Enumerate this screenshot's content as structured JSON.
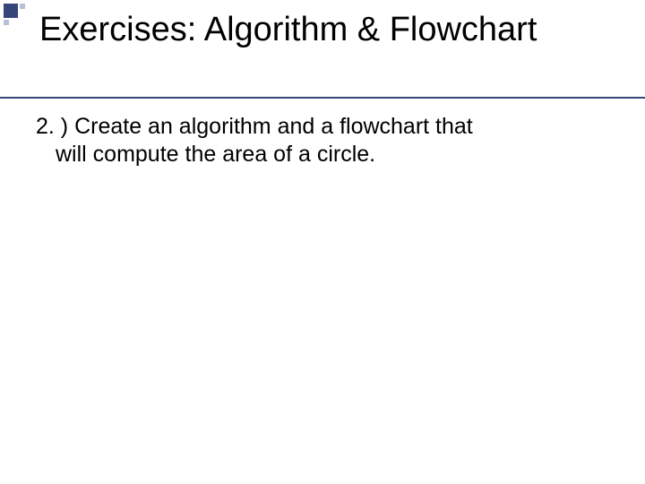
{
  "title": "Exercises: Algorithm & Flowchart",
  "body": {
    "line1": "2. ) Create an algorithm and a flowchart that",
    "line2": "will compute the area of a circle."
  }
}
